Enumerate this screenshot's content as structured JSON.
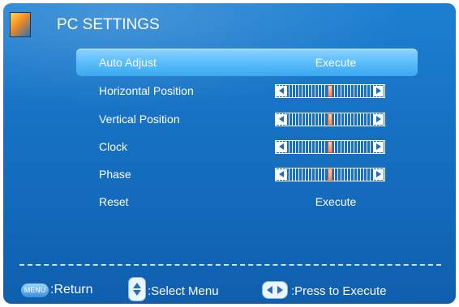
{
  "header": {
    "title": "PC SETTINGS",
    "logo_icon": "flower-icon"
  },
  "rows": [
    {
      "label": "Auto Adjust",
      "value": "Execute",
      "selected": true
    },
    {
      "label": "Horizontal Position",
      "slider_level": 0.5
    },
    {
      "label": "Vertical Position",
      "slider_level": 0.5
    },
    {
      "label": "Clock",
      "slider_level": 0.5
    },
    {
      "label": "Phase",
      "slider_level": 0.5
    },
    {
      "label": "Reset",
      "value": "Execute"
    }
  ],
  "footer": {
    "menu_key": "MENU",
    "menu_action": ":Return",
    "updown_action": ":Select Menu",
    "leftright_action": ":Press to Execute",
    "updown_icon": "up-down-arrows-icon",
    "leftright_icon": "left-right-arrows-icon"
  },
  "colors": {
    "background": "#1670c2",
    "selected_row": "#5fc0fb",
    "thumb": "#ee8e62"
  }
}
